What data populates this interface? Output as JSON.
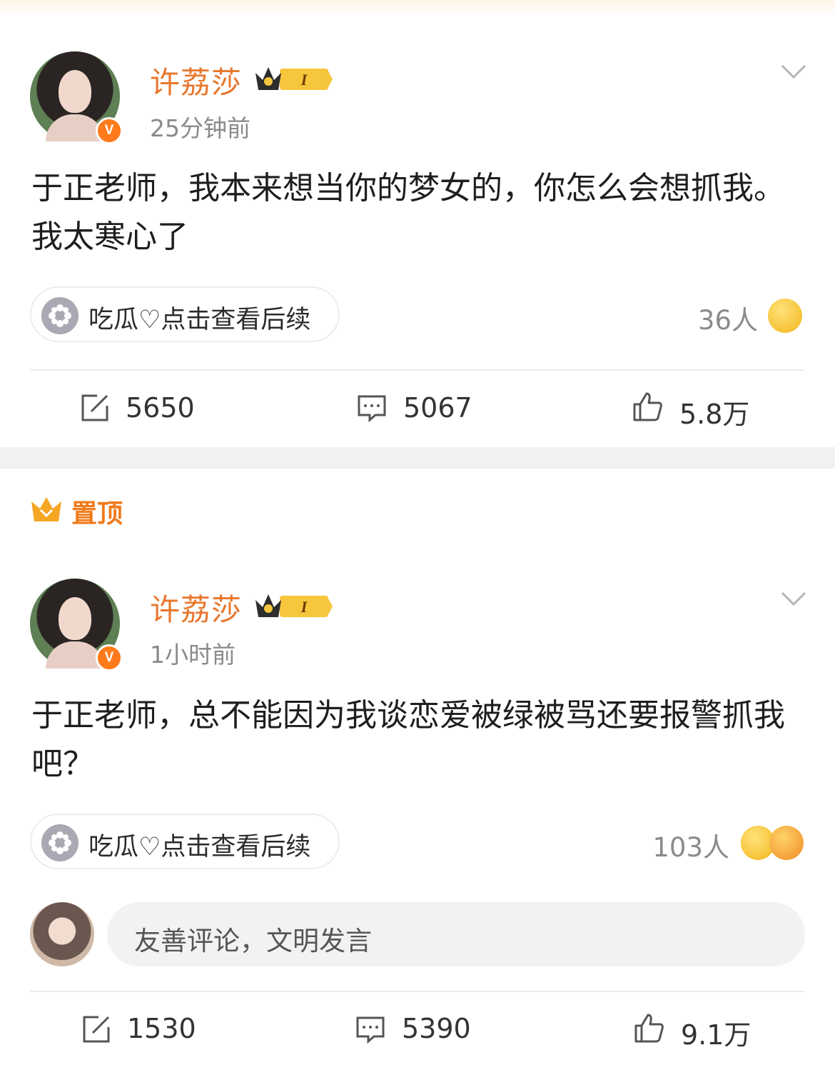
{
  "posts": [
    {
      "username": "许荔莎",
      "time": "25分钟前",
      "content": "于正老师，我本来想当你的梦女的，你怎么会想抓我。我太寒心了",
      "topic_pill": "吃瓜♡点击查看后续",
      "reaction_count": "36人",
      "reposts": "5650",
      "comments": "5067",
      "likes": "5.8万"
    },
    {
      "pinned_label": "置顶",
      "username": "许荔莎",
      "time": "1小时前",
      "content": "于正老师，总不能因为我谈恋爱被绿被骂还要报警抓我吧？",
      "topic_pill": "吃瓜♡点击查看后续",
      "reaction_count": "103人",
      "comment_placeholder": "友善评论，文明发言",
      "reposts": "1530",
      "comments": "5390",
      "likes": "9.1万"
    }
  ],
  "badges": {
    "verified": "V",
    "level": "I"
  },
  "colors": {
    "username": "#e8772d",
    "accent": "#ff7a1a",
    "muted": "#8a8a8a"
  }
}
